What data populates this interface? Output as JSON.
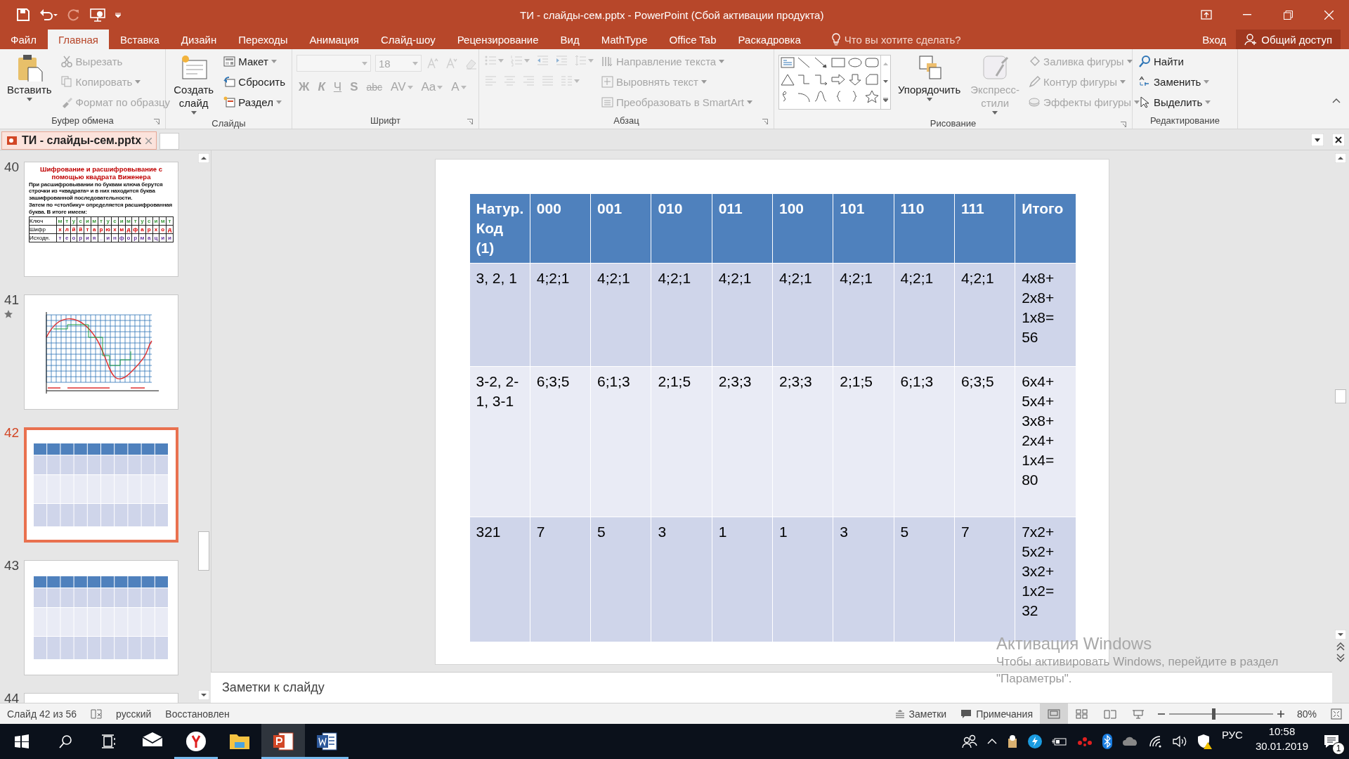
{
  "window": {
    "title": "ТИ - слайды-сем.pptx - PowerPoint (Сбой активации продукта)"
  },
  "ribbon": {
    "tabs": [
      {
        "label": "Файл",
        "selected": false
      },
      {
        "label": "Главная",
        "selected": true
      },
      {
        "label": "Вставка",
        "selected": false
      },
      {
        "label": "Дизайн",
        "selected": false
      },
      {
        "label": "Переходы",
        "selected": false
      },
      {
        "label": "Анимация",
        "selected": false
      },
      {
        "label": "Слайд-шоу",
        "selected": false
      },
      {
        "label": "Рецензирование",
        "selected": false
      },
      {
        "label": "Вид",
        "selected": false
      },
      {
        "label": "MathType",
        "selected": false
      },
      {
        "label": "Office Tab",
        "selected": false
      },
      {
        "label": "Раскадровка",
        "selected": false
      }
    ],
    "tell_me": {
      "placeholder": "Что вы хотите сделать?"
    },
    "sign_in": "Вход",
    "share": "Общий доступ",
    "groups": [
      {
        "label": "Буфер обмена",
        "sections": [
          {
            "kind": "large",
            "label": "Вставить",
            "disabled": false,
            "menu": true
          },
          {
            "kind": "stack",
            "items": [
              {
                "label": "Вырезать",
                "disabled": true,
                "menu": false
              },
              {
                "label": "Копировать",
                "disabled": true,
                "menu": true
              },
              {
                "label": "Формат по образцу",
                "disabled": true,
                "menu": false
              }
            ]
          }
        ]
      },
      {
        "label": "Слайды",
        "sections": [
          {
            "kind": "large",
            "label": "Создать слайд",
            "disabled": false,
            "menu": true
          },
          {
            "kind": "stack",
            "items": [
              {
                "label": "Макет",
                "disabled": false,
                "menu": true
              },
              {
                "label": "Сбросить",
                "disabled": false,
                "menu": false
              },
              {
                "label": "Раздел",
                "disabled": false,
                "menu": true
              }
            ]
          }
        ]
      },
      {
        "label": "Шрифт",
        "sections": [
          {
            "kind": "toolbar",
            "rows": [
              [
                {
                  "kind": "field",
                  "disabled": true
                },
                {
                  "kind": "field",
                  "value": "18",
                  "disabled": true
                },
                {
                  "kind": "icon",
                  "disabled": true,
                  "menu": false
                },
                {
                  "kind": "icon",
                  "disabled": true,
                  "menu": false
                },
                {
                  "kind": "icon",
                  "disabled": true,
                  "menu": false
                }
              ],
              [
                {
                  "kind": "glyph",
                  "text": "Ж",
                  "disabled": true,
                  "menu": false
                },
                {
                  "kind": "glyph",
                  "text": "К",
                  "disabled": true,
                  "menu": false
                },
                {
                  "kind": "glyph",
                  "text": "Ч",
                  "disabled": true,
                  "menu": false
                },
                {
                  "kind": "glyph",
                  "text": "S",
                  "disabled": true,
                  "menu": false
                },
                {
                  "kind": "glyph",
                  "text": "abc",
                  "disabled": true,
                  "menu": false
                },
                {
                  "kind": "glyph",
                  "text": "AV",
                  "disabled": true,
                  "menu": true
                },
                {
                  "kind": "glyph",
                  "text": "Aa",
                  "disabled": true,
                  "menu": true
                },
                {
                  "kind": "glyph",
                  "text": "A",
                  "disabled": true,
                  "menu": true
                }
              ]
            ]
          }
        ]
      },
      {
        "label": "Абзац",
        "sections": [
          {
            "kind": "toolbar",
            "rows": [
              [
                {
                  "kind": "icon",
                  "disabled": true,
                  "menu": true
                },
                {
                  "kind": "icon",
                  "disabled": true,
                  "menu": true
                },
                {
                  "kind": "icon",
                  "disabled": true,
                  "menu": false
                },
                {
                  "kind": "icon",
                  "disabled": true,
                  "menu": false
                },
                {
                  "kind": "icon",
                  "disabled": true,
                  "menu": true
                }
              ],
              [
                {
                  "kind": "icon",
                  "disabled": true,
                  "menu": false
                },
                {
                  "kind": "icon",
                  "disabled": true,
                  "menu": false
                },
                {
                  "kind": "icon",
                  "disabled": true,
                  "menu": false
                },
                {
                  "kind": "icon",
                  "disabled": true,
                  "menu": false
                },
                {
                  "kind": "icon",
                  "disabled": true,
                  "menu": true
                }
              ]
            ]
          },
          {
            "kind": "stack",
            "items": [
              {
                "label": "Направление текста",
                "disabled": true,
                "menu": true
              },
              {
                "label": "Выровнять текст",
                "disabled": true,
                "menu": true
              },
              {
                "label": "Преобразовать в SmartArt",
                "disabled": true,
                "menu": true
              }
            ]
          }
        ]
      },
      {
        "label": "Рисование",
        "sections": [
          {
            "kind": "gallery"
          },
          {
            "kind": "large",
            "label": "Упорядочить",
            "disabled": false,
            "menu": true
          },
          {
            "kind": "large",
            "label": "Экспресс-стили",
            "disabled": true,
            "menu": true
          },
          {
            "kind": "stack",
            "items": [
              {
                "label": "Заливка фигуры",
                "disabled": true,
                "menu": true
              },
              {
                "label": "Контур фигуры",
                "disabled": true,
                "menu": true
              },
              {
                "label": "Эффекты фигуры",
                "disabled": true,
                "menu": true
              }
            ]
          }
        ]
      },
      {
        "label": "Редактирование",
        "sections": [
          {
            "kind": "stack",
            "items": [
              {
                "label": "Найти",
                "disabled": false,
                "menu": false
              },
              {
                "label": "Заменить",
                "disabled": false,
                "menu": true
              },
              {
                "label": "Выделить",
                "disabled": false,
                "menu": true
              }
            ]
          }
        ]
      }
    ]
  },
  "document_tab": {
    "label": "ТИ - слайды-сем.pptx"
  },
  "thumbnails": [
    {
      "number": "40",
      "selected": false,
      "animated": false,
      "kind": "text",
      "title": "Шифрование и расшифровывание с помощью квадрата  Виженера",
      "paragraphs": [
        "При расшифровывании по буквам ключа берутся строчки из «квадрата» и в них находится буква зашифрованной последовательности.",
        "Затем по «столбику» определяется расшифрованная буква. В итоге имеем:"
      ],
      "table": [
        {
          "label": "Ключ",
          "letters": [
            "м",
            "т",
            "у",
            "с",
            "и",
            "м",
            "т",
            "у",
            "с",
            "и",
            "м",
            "т",
            "у",
            "с",
            "и",
            "м",
            "т"
          ]
        },
        {
          "label": "Шифр",
          "letters": [
            "х",
            "л",
            "й",
            "й",
            "т",
            "а",
            "р",
            "ю",
            "х",
            "м",
            "д",
            "ф",
            "а",
            "р",
            "х",
            "о",
            "д"
          ]
        },
        {
          "label": "Исходн.",
          "letters": [
            "т",
            "е",
            "о",
            "р",
            "и",
            "я",
            "_",
            "и",
            "н",
            "ф",
            "о",
            "р",
            "м",
            "а",
            "ц",
            "и",
            "и"
          ]
        }
      ]
    },
    {
      "number": "41",
      "selected": false,
      "animated": true,
      "kind": "graph"
    },
    {
      "number": "42",
      "selected": true,
      "animated": false,
      "kind": "table"
    },
    {
      "number": "43",
      "selected": false,
      "animated": false,
      "kind": "table"
    },
    {
      "number": "44",
      "selected": false,
      "animated": false,
      "kind": "partial"
    }
  ],
  "slide": {
    "table": {
      "columns": [
        "Натур. Код (1)",
        "000",
        "001",
        "010",
        "011",
        "100",
        "101",
        "110",
        "111",
        "Итого"
      ],
      "rows": [
        [
          "3, 2, 1",
          "4;2;1",
          "4;2;1",
          "4;2;1",
          "4;2;1",
          "4;2;1",
          "4;2;1",
          "4;2;1",
          "4;2;1",
          "4x8+\n2x8+\n1x8=\n56"
        ],
        [
          "3-2, 2-1, 3-1",
          "6;3;5",
          "6;1;3",
          "2;1;5",
          "2;3;3",
          "2;3;3",
          "2;1;5",
          "6;1;3",
          "6;3;5",
          "6x4+\n5x4+\n3x8+\n2x4+\n1x4=\n80"
        ],
        [
          "321",
          "7",
          "5",
          "3",
          "1",
          "1",
          "3",
          "5",
          "7",
          "7x2+\n5x2+\n3x2+\n1x2=\n32"
        ]
      ]
    }
  },
  "activation_notice": {
    "title": "Активация Windows",
    "text": "Чтобы активировать Windows, перейдите в раздел",
    "text_2": "\"Параметры\"."
  },
  "notes": {
    "placeholder": "Заметки к слайду"
  },
  "status_bar": {
    "slide": "Слайд 42 из 56",
    "language": "русский",
    "state": "Восстановлен",
    "notes": "Заметки",
    "comments": "Примечания",
    "views": [
      {
        "selected": true
      },
      {
        "selected": false
      },
      {
        "selected": false
      },
      {
        "selected": false
      }
    ],
    "zoom": {
      "level": 0.43,
      "reading": "80%"
    }
  },
  "taskbar": {
    "apps": [
      {
        "kind": "mail",
        "running": false,
        "selected": false
      },
      {
        "kind": "browser",
        "running": true,
        "selected": false
      },
      {
        "kind": "explorer",
        "running": false,
        "selected": false
      },
      {
        "kind": "powerpoint",
        "running": true,
        "selected": true
      },
      {
        "kind": "word",
        "running": true,
        "selected": false
      }
    ],
    "language": "РУС",
    "time": "10:58",
    "date": "30.01.2019",
    "notifications": "1"
  }
}
